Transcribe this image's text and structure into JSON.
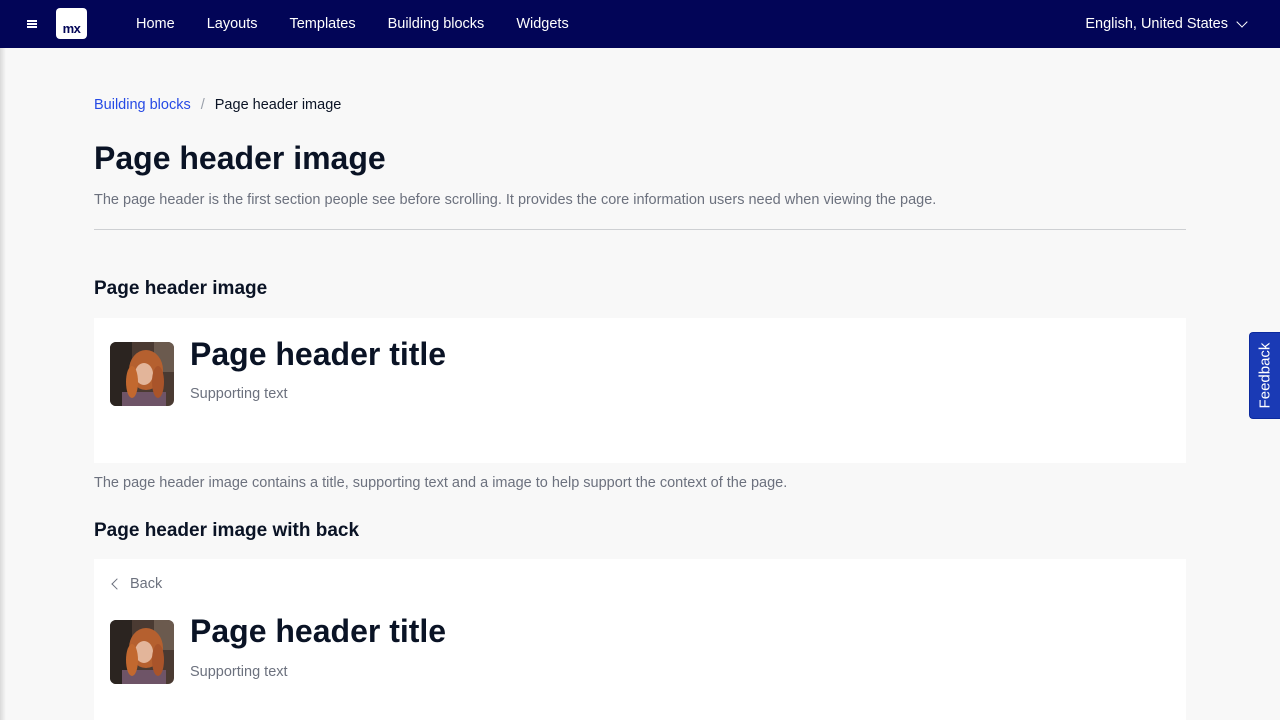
{
  "topbar": {
    "logo_text": "mx",
    "nav": [
      "Home",
      "Layouts",
      "Templates",
      "Building blocks",
      "Widgets"
    ],
    "language": "English, United States",
    "background": "#020557"
  },
  "breadcrumb": {
    "parent": "Building blocks",
    "separator": "/",
    "current": "Page header image"
  },
  "page": {
    "title": "Page header image",
    "description": "The page header is the first section people see before scrolling. It provides the core information users need when viewing the page."
  },
  "sections": [
    {
      "title": "Page header image",
      "header_title": "Page header title",
      "supporting_text": "Supporting text",
      "caption": "The page header image contains a title, supporting text and a image to help support the context of the page."
    },
    {
      "title": "Page header image with back",
      "back_label": "Back",
      "header_title": "Page header title",
      "supporting_text": "Supporting text"
    }
  ],
  "feedback_label": "Feedback",
  "colors": {
    "accent": "#264ae5",
    "text": "#0a1325",
    "muted": "#6c717e",
    "feedback": "#1a3ab5"
  }
}
